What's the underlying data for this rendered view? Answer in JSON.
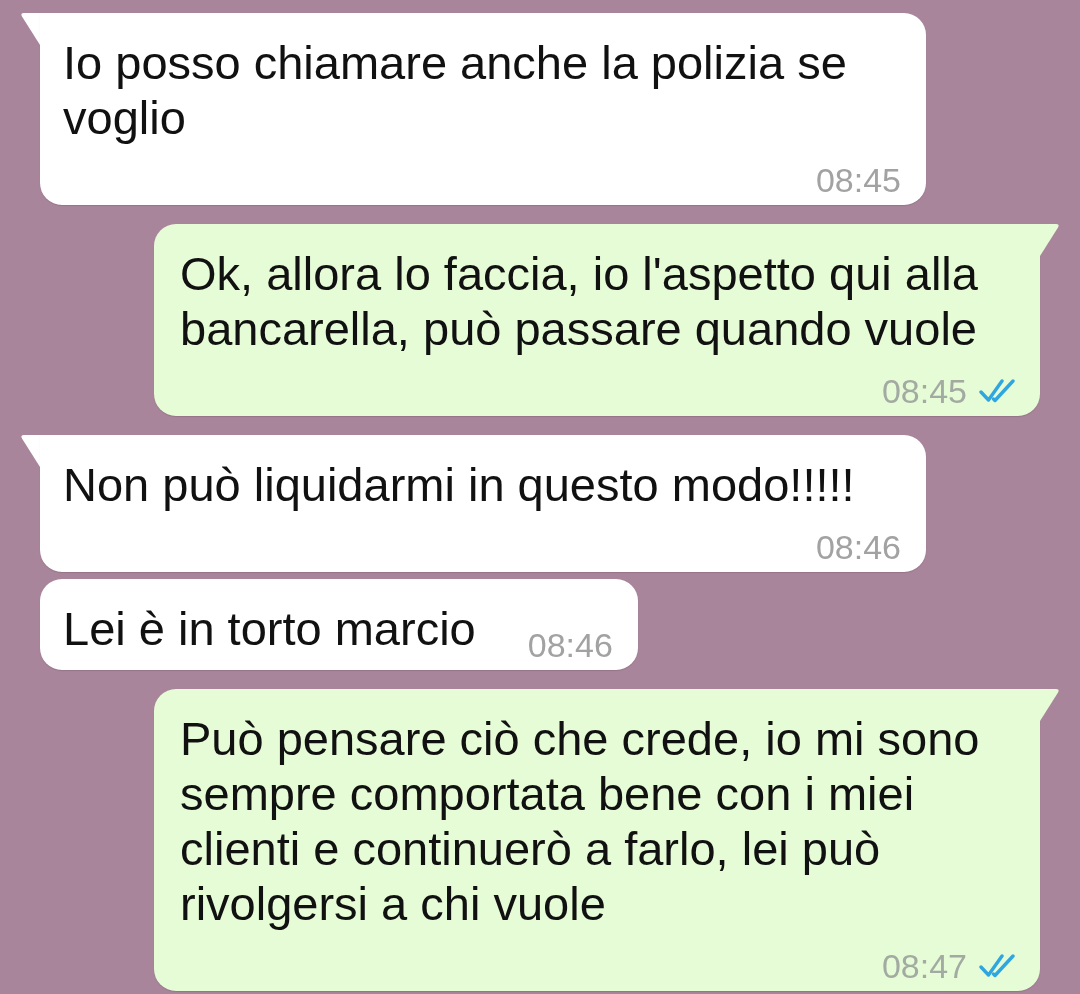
{
  "messages": [
    {
      "kind": "incoming",
      "tail": true,
      "text": "Io posso chiamare anche la polizia se voglio",
      "time": "08:45"
    },
    {
      "kind": "outgoing",
      "tail": true,
      "text": "Ok, allora lo faccia, io l'aspetto qui alla bancarella, può passare quando vuole",
      "time": "08:45",
      "read": true
    },
    {
      "kind": "incoming",
      "tail": true,
      "text": "Non può liquidarmi in questo modo!!!!!",
      "time": "08:46"
    },
    {
      "kind": "incoming",
      "tail": false,
      "text": "Lei è in torto marcio",
      "time": "08:46"
    },
    {
      "kind": "outgoing",
      "tail": true,
      "text": "Può pensare ciò che crede, io mi sono sempre comportata bene con i miei clienti e continuerò a farlo, lei può rivolgersi a chi vuole",
      "time": "08:47",
      "read": true
    }
  ]
}
